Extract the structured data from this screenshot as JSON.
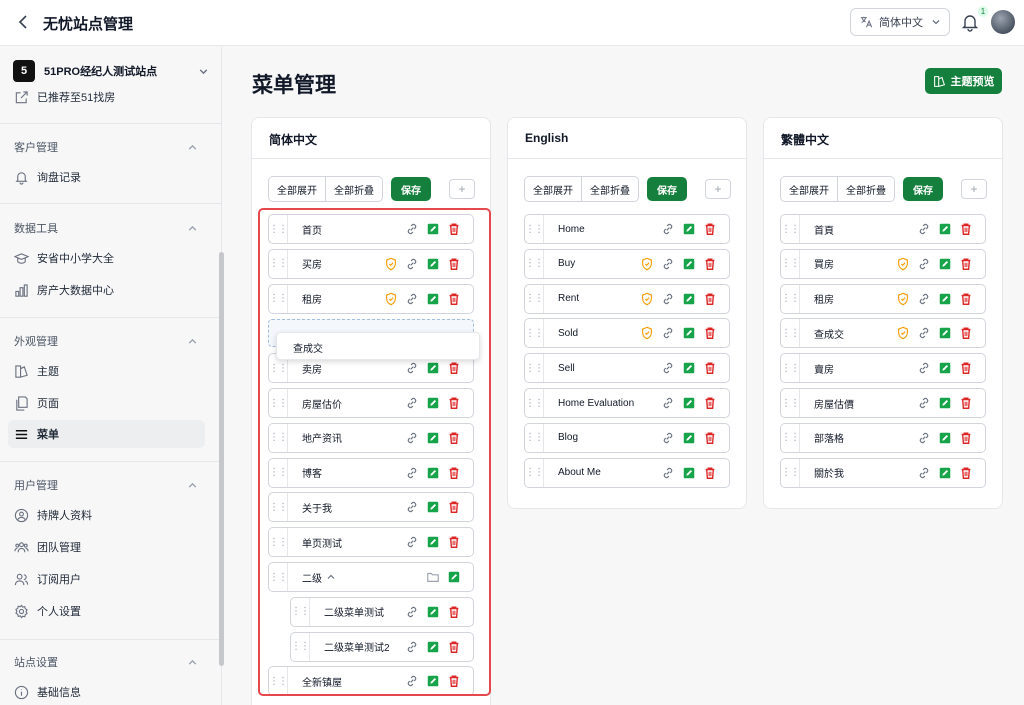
{
  "header": {
    "title": "无忧站点管理",
    "language": "简体中文",
    "notification_count": "1"
  },
  "sidebar": {
    "site_number": "5",
    "site_name": "51PRO经纪人测试站点",
    "recommend": "已推荐至51找房",
    "sections": [
      {
        "title": "客户管理",
        "items": [
          {
            "label": "询盘记录",
            "icon": "bell-icon"
          }
        ]
      },
      {
        "title": "数据工具",
        "items": [
          {
            "label": "安省中小学大全",
            "icon": "graduation-cap-icon"
          },
          {
            "label": "房产大数据中心",
            "icon": "bar-chart-icon"
          }
        ]
      },
      {
        "title": "外观管理",
        "items": [
          {
            "label": "主题",
            "icon": "palette-icon"
          },
          {
            "label": "页面",
            "icon": "pages-icon"
          },
          {
            "label": "菜单",
            "icon": "menu-icon",
            "active": true
          }
        ]
      },
      {
        "title": "用户管理",
        "items": [
          {
            "label": "持牌人资料",
            "icon": "user-circle-icon"
          },
          {
            "label": "团队管理",
            "icon": "team-icon"
          },
          {
            "label": "订阅用户",
            "icon": "users-icon"
          },
          {
            "label": "个人设置",
            "icon": "gear-icon"
          }
        ]
      },
      {
        "title": "站点设置",
        "items": [
          {
            "label": "基础信息",
            "icon": "info-icon"
          }
        ]
      }
    ]
  },
  "main": {
    "title": "菜单管理",
    "preview_label": "主题预览",
    "expand_all": "全部展开",
    "save": "保存",
    "add": "+"
  },
  "panels": [
    {
      "title": "简体中文",
      "collapse_all": "全部折叠",
      "dragging": "查成交",
      "items": [
        {
          "label": "首页",
          "shield": false
        },
        {
          "label": "买房",
          "shield": true
        },
        {
          "label": "租房",
          "shield": true
        },
        {
          "label": "卖房",
          "shield": false
        },
        {
          "label": "房屋估价",
          "shield": false
        },
        {
          "label": "地产资讯",
          "shield": false
        },
        {
          "label": "博客",
          "shield": false
        },
        {
          "label": "关于我",
          "shield": false
        },
        {
          "label": "单页测试",
          "shield": false
        },
        {
          "label": "二级",
          "folder": true
        },
        {
          "label": "二级菜单测试",
          "child": true
        },
        {
          "label": "二级菜单测试2",
          "child": true
        },
        {
          "label": "全新镇屋",
          "shield": false
        }
      ]
    },
    {
      "title": "English",
      "collapse_all": "全部折叠",
      "items": [
        {
          "label": "Home",
          "shield": false
        },
        {
          "label": "Buy",
          "shield": true
        },
        {
          "label": "Rent",
          "shield": true
        },
        {
          "label": "Sold",
          "shield": true
        },
        {
          "label": "Sell",
          "shield": false
        },
        {
          "label": "Home Evaluation",
          "shield": false
        },
        {
          "label": "Blog",
          "shield": false
        },
        {
          "label": "About Me",
          "shield": false
        }
      ]
    },
    {
      "title": "繁體中文",
      "collapse_all": "全部折疊",
      "items": [
        {
          "label": "首頁",
          "shield": false
        },
        {
          "label": "買房",
          "shield": true
        },
        {
          "label": "租房",
          "shield": true
        },
        {
          "label": "查成交",
          "shield": true
        },
        {
          "label": "賣房",
          "shield": false
        },
        {
          "label": "房屋估價",
          "shield": false
        },
        {
          "label": "部落格",
          "shield": false
        },
        {
          "label": "關於我",
          "shield": false
        }
      ]
    }
  ]
}
